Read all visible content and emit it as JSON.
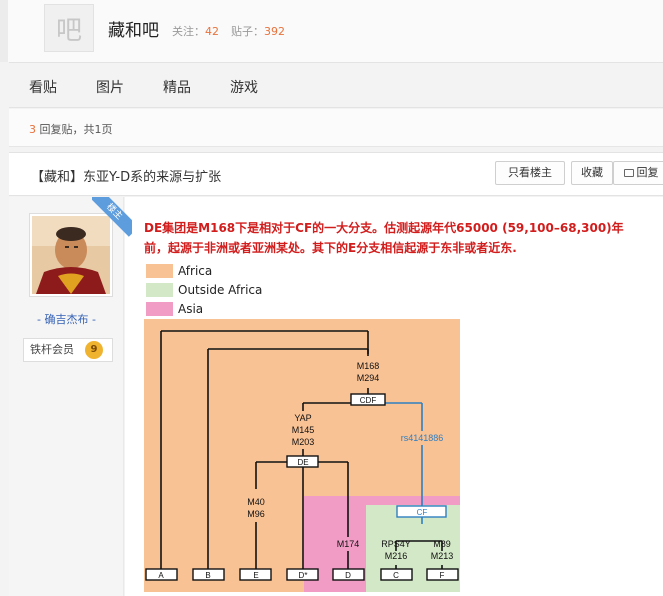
{
  "forum": {
    "logo_char": "吧",
    "name": "藏和吧",
    "follow_label": "关注：",
    "follow_count": "42",
    "posts_label": "贴子：",
    "posts_count": "392"
  },
  "nav": {
    "tabs": [
      "看贴",
      "图片",
      "精品",
      "游戏"
    ]
  },
  "pager": {
    "reply_count": "3",
    "reply_suffix": " 回复贴，共1页"
  },
  "thread": {
    "title": "【藏和】东亚Y-D系的来源与扩张",
    "buttons": {
      "only_op": "只看楼主",
      "favorite": "收藏",
      "reply": "回复"
    }
  },
  "author": {
    "name": "- 确吉杰布 -",
    "badge_label": "铁杆会员",
    "level": "9",
    "op_ribbon": "楼主"
  },
  "post": {
    "text": "DE集团是M168下是相对于CF的一大分支。估测起源年代65000 (59,100–68,300)年前，起源于非洲或者亚洲某处。其下的E分支相信起源于东非或者近东."
  },
  "figure": {
    "legend": [
      {
        "label": "Africa",
        "color": "#f9c295"
      },
      {
        "label": "Outside Africa",
        "color": "#d3e8c7"
      },
      {
        "label": "Asia",
        "color": "#f19cc4"
      }
    ],
    "colors": {
      "africa": "#f9c295",
      "outside": "#d3e8c7",
      "asia": "#f19cc4",
      "blue": "#2f7fc1"
    },
    "nodes": {
      "m168": "M168",
      "m294": "M294",
      "cdf": "CDF",
      "yap": "YAP",
      "m145": "M145",
      "m203": "M203",
      "de": "DE",
      "rs": "rs4141886",
      "m40": "M40",
      "m96": "M96",
      "m174": "M174",
      "cf": "CF",
      "rps4y": "RPS4Y",
      "m216": "M216",
      "m89": "M89",
      "m213": "M213"
    },
    "leaves": {
      "a": "A",
      "b": "B",
      "e": "E",
      "dstar": "D*",
      "d": "D",
      "c": "C",
      "f": "F"
    }
  }
}
